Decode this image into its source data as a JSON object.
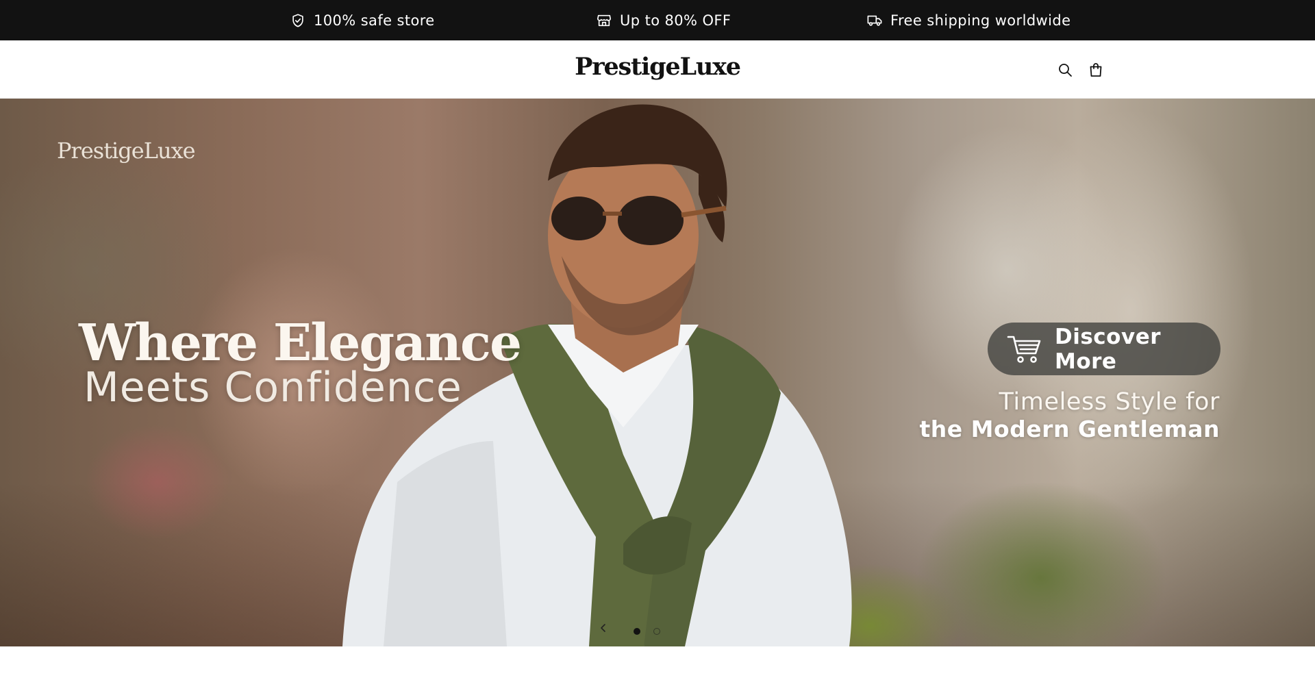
{
  "announcement": {
    "items": [
      {
        "icon": "shield-check-icon",
        "text": "100% safe store"
      },
      {
        "icon": "store-icon",
        "text": "Up to 80% OFF"
      },
      {
        "icon": "truck-icon",
        "text": "Free shipping worldwide"
      }
    ]
  },
  "header": {
    "logo": "PrestigeLuxe",
    "icons": [
      "search-icon",
      "shopping-bag-icon"
    ]
  },
  "hero": {
    "brand_mark": "PrestigeLuxe",
    "title": "Where Elegance",
    "subtitle": "Meets Confidence",
    "cta_label": "Discover More",
    "cta_icon": "shopping-cart-icon",
    "tagline_line1": "Timeless Style for",
    "tagline_line2": "the Modern Gentleman"
  },
  "slider": {
    "total_slides": 2,
    "active_slide": 1
  },
  "colors": {
    "announcement_bg": "#121212",
    "announcement_text": "#ffffff",
    "header_bg": "#ffffff",
    "logo": "#121212",
    "cta_bg": "#46463f",
    "active_dot": "#121212"
  }
}
